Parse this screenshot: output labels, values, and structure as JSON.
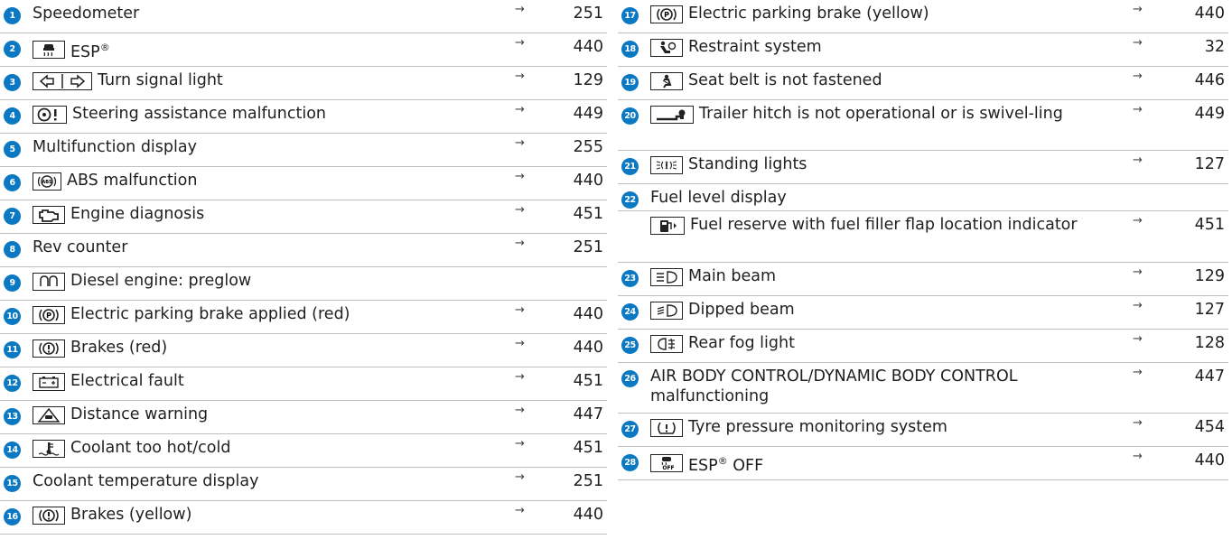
{
  "left": [
    {
      "num": "1",
      "icon": null,
      "text": "Speedometer",
      "arrow": "→",
      "page": "251",
      "h": 37
    },
    {
      "num": "2",
      "icon": "esp-icon",
      "text": "ESP",
      "sup": "®",
      "arrow": "→",
      "page": "440",
      "h": 37
    },
    {
      "num": "3",
      "icon": "turn-signal-icons",
      "text": "Turn signal light",
      "arrow": "→",
      "page": "129",
      "h": 37
    },
    {
      "num": "4",
      "icon": "steering-assist-icon",
      "text": "Steering assistance malfunction",
      "arrow": "→",
      "page": "449",
      "h": 37
    },
    {
      "num": "5",
      "icon": null,
      "text": "Multifunction display",
      "arrow": "→",
      "page": "255",
      "h": 37
    },
    {
      "num": "6",
      "icon": "abs-icon",
      "text": "ABS malfunction",
      "arrow": "→",
      "page": "440",
      "h": 37
    },
    {
      "num": "7",
      "icon": "engine-diagnosis-icon",
      "text": "Engine diagnosis",
      "arrow": "→",
      "page": "451",
      "h": 37
    },
    {
      "num": "8",
      "icon": null,
      "text": "Rev counter",
      "arrow": "→",
      "page": "251",
      "h": 37
    },
    {
      "num": "9",
      "icon": "preglow-icon",
      "text": "Diesel engine: preglow",
      "arrow": "",
      "page": "",
      "h": 37
    },
    {
      "num": "10",
      "icon": "parking-brake-icon",
      "text": "Electric parking brake applied (red)",
      "arrow": "→",
      "page": "440",
      "h": 37
    },
    {
      "num": "11",
      "icon": "brake-icon",
      "text": "Brakes (red)",
      "arrow": "→",
      "page": "440",
      "h": 37
    },
    {
      "num": "12",
      "icon": "battery-icon",
      "text": "Electrical fault",
      "arrow": "→",
      "page": "451",
      "h": 37
    },
    {
      "num": "13",
      "icon": "distance-warning-icon",
      "text": "Distance warning",
      "arrow": "→",
      "page": "447",
      "h": 37
    },
    {
      "num": "14",
      "icon": "coolant-icon",
      "text": "Coolant too hot/cold",
      "arrow": "→",
      "page": "451",
      "h": 37
    },
    {
      "num": "15",
      "icon": null,
      "text": "Coolant temperature display",
      "arrow": "→",
      "page": "251",
      "h": 37
    },
    {
      "num": "16",
      "icon": "brake-icon",
      "text": "Brakes (yellow)",
      "arrow": "→",
      "page": "440",
      "h": 37
    }
  ],
  "right": [
    {
      "num": "17",
      "icon": "parking-brake-icon",
      "text": "Electric parking brake (yellow)",
      "arrow": "→",
      "page": "440",
      "h": 37
    },
    {
      "num": "18",
      "icon": "restraint-icon",
      "text": "Restraint system",
      "arrow": "→",
      "page": "32",
      "h": 37
    },
    {
      "num": "19",
      "icon": "seatbelt-icon",
      "text": "Seat belt is not fastened",
      "arrow": "→",
      "page": "446",
      "h": 37
    },
    {
      "num": "20",
      "icon": "trailer-hitch-icon",
      "text": "Trailer hitch is not operational or is swivel-ling",
      "arrow": "→",
      "page": "449",
      "h": 56
    },
    {
      "num": "21",
      "icon": "standing-lights-icon",
      "text": "Standing lights",
      "arrow": "→",
      "page": "127",
      "h": 37
    },
    {
      "num": "22",
      "icon": null,
      "text": "Fuel level display",
      "arrow": "",
      "page": "",
      "h": 30
    },
    {
      "num": "",
      "icon": "fuel-reserve-icon",
      "text": "Fuel reserve with fuel filler flap location indicator",
      "arrow": "→",
      "page": "451",
      "h": 57
    },
    {
      "num": "23",
      "icon": "main-beam-icon",
      "text": "Main beam",
      "arrow": "→",
      "page": "129",
      "h": 37
    },
    {
      "num": "24",
      "icon": "dipped-beam-icon",
      "text": "Dipped beam",
      "arrow": "→",
      "page": "127",
      "h": 37
    },
    {
      "num": "25",
      "icon": "rear-fog-icon",
      "text": "Rear fog light",
      "arrow": "→",
      "page": "128",
      "h": 37
    },
    {
      "num": "26",
      "icon": null,
      "text": "AIR BODY CONTROL/DYNAMIC BODY CONTROL malfunctioning",
      "arrow": "→",
      "page": "447",
      "h": 56
    },
    {
      "num": "27",
      "icon": "tyre-pressure-icon",
      "text": "Tyre pressure monitoring system",
      "arrow": "→",
      "page": "454",
      "h": 37
    },
    {
      "num": "28",
      "icon": "esp-off-icon",
      "text": "ESP",
      "sup": "®",
      "text2": " OFF",
      "arrow": "→",
      "page": "440",
      "h": 37
    }
  ],
  "colors": {
    "badge": "#0a78c2",
    "rule": "#bfbfbf"
  }
}
